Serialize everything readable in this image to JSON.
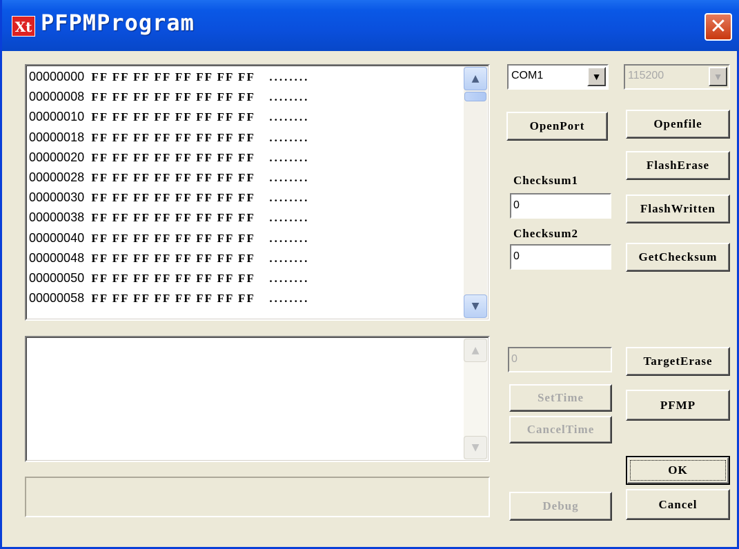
{
  "window": {
    "title": "PFPMProgram",
    "icon_text": "Xt",
    "close_glyph": "✕"
  },
  "hex_view": {
    "lines": [
      {
        "addr": "00000000",
        "bytes": "FF FF FF FF FF FF FF FF",
        "ascii": "........"
      },
      {
        "addr": "00000008",
        "bytes": "FF FF FF FF FF FF FF FF",
        "ascii": "........"
      },
      {
        "addr": "00000010",
        "bytes": "FF FF FF FF FF FF FF FF",
        "ascii": "........"
      },
      {
        "addr": "00000018",
        "bytes": "FF FF FF FF FF FF FF FF",
        "ascii": "........"
      },
      {
        "addr": "00000020",
        "bytes": "FF FF FF FF FF FF FF FF",
        "ascii": "........"
      },
      {
        "addr": "00000028",
        "bytes": "FF FF FF FF FF FF FF FF",
        "ascii": "........"
      },
      {
        "addr": "00000030",
        "bytes": "FF FF FF FF FF FF FF FF",
        "ascii": "........"
      },
      {
        "addr": "00000038",
        "bytes": "FF FF FF FF FF FF FF FF",
        "ascii": "........"
      },
      {
        "addr": "00000040",
        "bytes": "FF FF FF FF FF FF FF FF",
        "ascii": "........"
      },
      {
        "addr": "00000048",
        "bytes": "FF FF FF FF FF FF FF FF",
        "ascii": "........"
      },
      {
        "addr": "00000050",
        "bytes": "FF FF FF FF FF FF FF FF",
        "ascii": "........"
      },
      {
        "addr": "00000058",
        "bytes": "FF FF FF FF FF FF FF FF",
        "ascii": "........"
      }
    ],
    "scroll_up_glyph": "▲",
    "scroll_down_glyph": "▼"
  },
  "log_view": {
    "text": "",
    "scroll_up_glyph": "▲",
    "scroll_down_glyph": "▼"
  },
  "status_text": "",
  "controls": {
    "port_select": {
      "value": "COM1",
      "arrow": "▼"
    },
    "baud_select": {
      "value": "115200",
      "arrow": "▼"
    },
    "open_port": "OpenPort",
    "open_file": "Openfile",
    "flash_erase": "FlashErase",
    "flash_written": "FlashWritten",
    "get_checksum": "GetChecksum",
    "checksum1_label": "Checksum1",
    "checksum1_value": "0",
    "checksum2_label": "Checksum2",
    "checksum2_value": "0",
    "time_value": "0",
    "set_time": "SetTime",
    "cancel_time": "CancelTime",
    "target_erase": "TargetErase",
    "pfmp": "PFMP",
    "ok": "OK",
    "debug": "Debug",
    "cancel": "Cancel"
  }
}
